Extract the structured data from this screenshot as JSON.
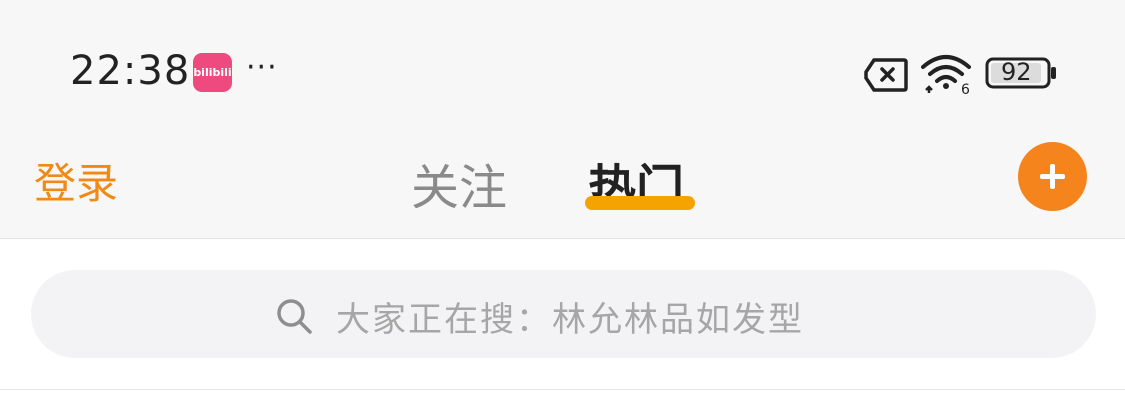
{
  "status_bar": {
    "time": "22:38",
    "app_icon_text": "bilibili",
    "more_indicator": "···",
    "battery_level": "92",
    "icons": [
      "sim-icon",
      "wifi-icon",
      "battery-icon"
    ]
  },
  "nav": {
    "login_label": "登录",
    "tabs": [
      {
        "label": "关注",
        "active": false
      },
      {
        "label": "热门",
        "active": true
      }
    ],
    "add_icon": "plus-icon"
  },
  "search": {
    "placeholder": "大家正在搜：林允林品如发型",
    "icon": "search-icon"
  },
  "colors": {
    "accent": "#f08a14",
    "indicator": "#f5a300",
    "add_button": "#f5841c",
    "app_icon": "#ee4a7f"
  }
}
